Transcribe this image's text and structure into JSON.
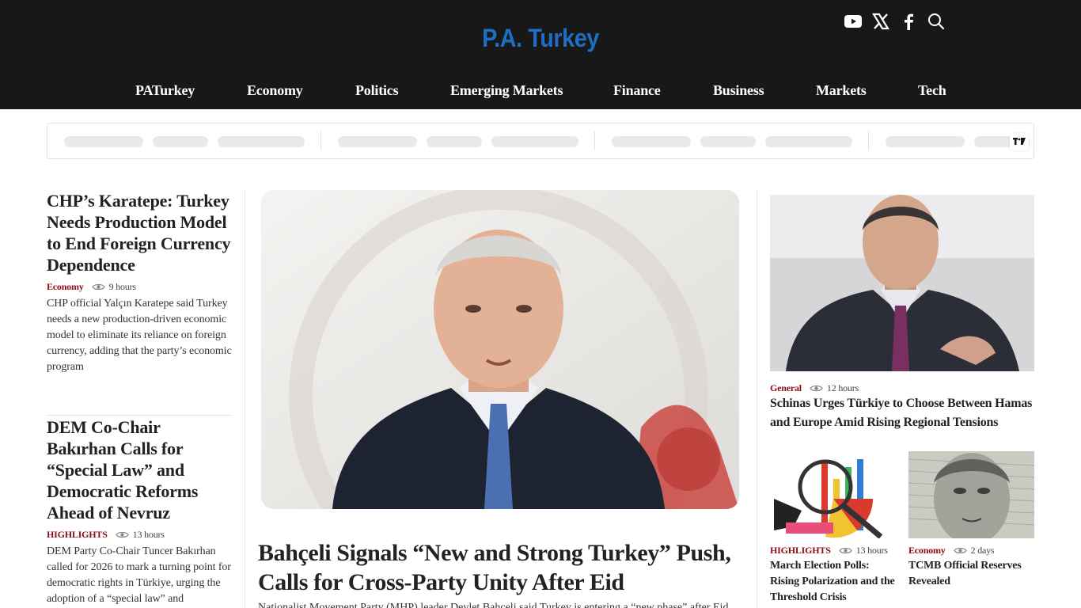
{
  "site": {
    "logo": "P.A. Turkey",
    "social_icons": [
      "youtube-icon",
      "x-icon",
      "facebook-icon",
      "search-icon"
    ],
    "brand_color": "#1e6fc4",
    "category_color": "#8b0d14"
  },
  "nav": {
    "items": [
      {
        "label": "PATurkey"
      },
      {
        "label": "Economy"
      },
      {
        "label": "Politics"
      },
      {
        "label": "Emerging Markets"
      },
      {
        "label": "Finance"
      },
      {
        "label": "Business"
      },
      {
        "label": "Markets"
      },
      {
        "label": "Tech"
      }
    ]
  },
  "left": {
    "articles": [
      {
        "title": "CHP’s Karatepe: Turkey Needs Production Model to End Foreign Currency Dependence",
        "category": "Economy",
        "time": "9 hours",
        "excerpt": "CHP official Yalçın Karatepe said Turkey needs a new production-driven economic model to eliminate its reliance on foreign currency, adding that the party’s economic program"
      },
      {
        "title": "DEM Co-Chair Bakırhan Calls for “Special Law” and Democratic Reforms Ahead of Nevruz",
        "category": "HIGHLIGHTS",
        "time": "13 hours",
        "excerpt": "DEM Party Co-Chair Tuncer Bakırhan called for 2026 to mark a turning point for democratic rights in Türkiye, urging the adoption of a “special law” and"
      }
    ]
  },
  "center": {
    "title": "Bahçeli Signals “New and Strong Turkey” Push, Calls for Cross-Party Unity After Eid",
    "excerpt": "Nationalist Movement Party (MHP) leader Devlet Bahçeli said Turkey is entering a “new phase” after Eid"
  },
  "right": {
    "main": {
      "category": "General",
      "time": "12 hours",
      "title": "Schinas Urges Türkiye to Choose Between Hamas and Europe Amid Rising Regional Tensions"
    },
    "small": [
      {
        "category": "HIGHLIGHTS",
        "time": "13 hours",
        "title": "March Election Polls: Rising Polarization and the Threshold Crisis"
      },
      {
        "category": "Economy",
        "time": "2 days",
        "title": "TCMB Official Reserves Revealed"
      }
    ]
  }
}
